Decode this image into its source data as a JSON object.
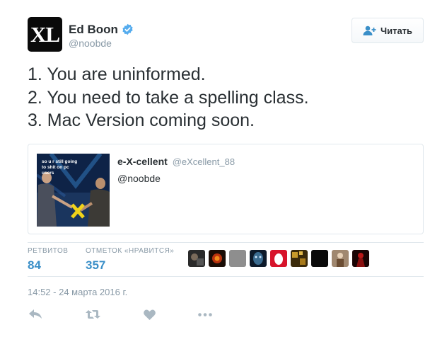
{
  "tweet": {
    "avatar_text": "XL",
    "display_name": "Ed Boon",
    "handle": "@noobde",
    "follow_label": "Читать",
    "lines": [
      "1. You are uninformed.",
      "2. You need to take a spelling class.",
      "3. Mac Version coming soon."
    ],
    "timestamp": "14:52 - 24 марта 2016 г."
  },
  "quote": {
    "name": "e-X-cellent",
    "handle": "@eXcellent_88",
    "text": "@noobde",
    "image_caption": "so u r still going to shit on pc users"
  },
  "stats": {
    "retweets_label": "РЕТВИТОВ",
    "retweets_value": "84",
    "likes_label": "ОТМЕТОК «НРАВИТСЯ»",
    "likes_value": "357"
  },
  "likers": [
    {
      "icon": "avatar-dark-scene"
    },
    {
      "icon": "avatar-red-orange"
    },
    {
      "icon": "avatar-gray"
    },
    {
      "icon": "avatar-blue-face"
    },
    {
      "icon": "avatar-red-egg"
    },
    {
      "icon": "avatar-gold-pattern"
    },
    {
      "icon": "avatar-black"
    },
    {
      "icon": "avatar-figure"
    },
    {
      "icon": "avatar-red-figure"
    }
  ],
  "colors": {
    "accent": "#3a8fc8",
    "verified": "#55acee",
    "muted": "#8899a6",
    "border": "#e1e8ed"
  },
  "icons": {
    "follow": "add-user-icon",
    "verified": "verified-badge-icon",
    "reply": "reply-icon",
    "retweet": "retweet-icon",
    "like": "heart-icon",
    "more": "more-icon"
  }
}
